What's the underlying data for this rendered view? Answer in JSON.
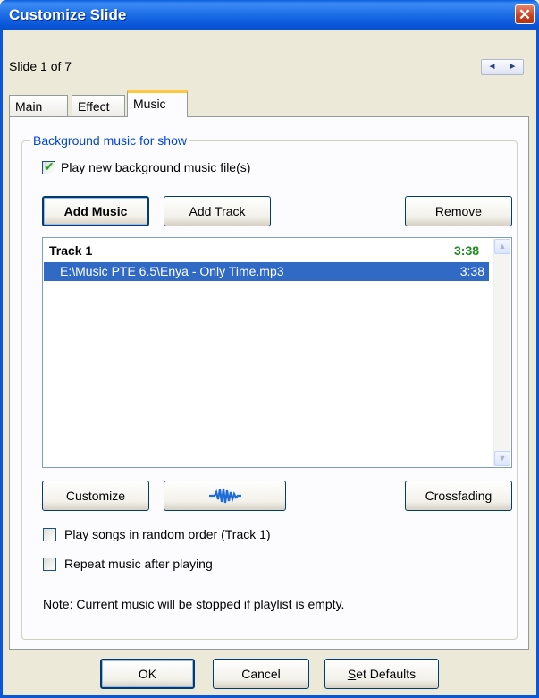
{
  "window": {
    "title": "Customize Slide",
    "close_glyph": "✕"
  },
  "slide_nav": {
    "info": "Slide 1 of 7",
    "prev": "◄",
    "next": "►"
  },
  "tabs": [
    {
      "label": "Main"
    },
    {
      "label": "Effect"
    },
    {
      "label": "Music",
      "active": true
    }
  ],
  "group": {
    "legend": "Background music for show"
  },
  "play_new": {
    "label": "Play new background music file(s)",
    "checked": true
  },
  "buttons": {
    "add_music": "Add Music",
    "add_track": "Add Track",
    "remove": "Remove",
    "customize": "Customize",
    "crossfading": "Crossfading",
    "ok": "OK",
    "cancel": "Cancel",
    "set_defaults_prefix": "S",
    "set_defaults_rest": "et Defaults"
  },
  "waveform_button": {
    "icon": "waveform-icon"
  },
  "playlist": {
    "track_title": "Track 1",
    "track_duration": "3:38",
    "items": [
      {
        "name": "E:\\Music PTE 6.5\\Enya - Only Time.mp3",
        "duration": "3:38",
        "selected": true
      }
    ],
    "scroll_up": "▲",
    "scroll_down": "▼"
  },
  "random_order": {
    "label": "Play songs in random order (Track 1)",
    "checked": false
  },
  "repeat_music": {
    "label": "Repeat music after playing",
    "checked": false
  },
  "note": "Note: Current music will be stopped if playlist is empty.",
  "colors": {
    "title_bar": "#0a5fe0",
    "selection": "#316ac5",
    "track_duration": "#1e8c1e",
    "legend": "#0046d5"
  }
}
